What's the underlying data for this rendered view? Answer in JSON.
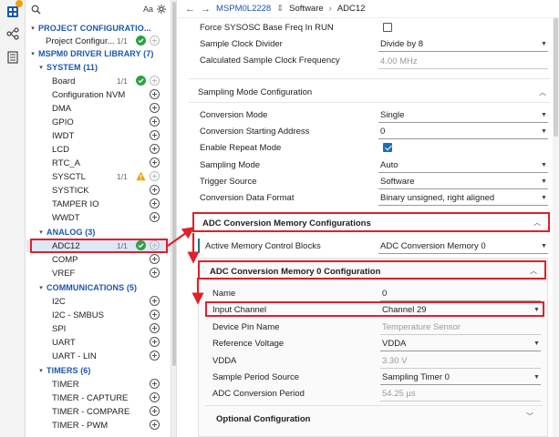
{
  "breadcrumb": {
    "device": "MSPM0L2228",
    "section": "Software",
    "page": "ADC12"
  },
  "tree": {
    "search_icon": "search-icon",
    "case_toggle": "Aa",
    "groups": [
      {
        "id": "project",
        "label": "PROJECT CONFIGURATIO...",
        "level": 0
      },
      {
        "id": "project-item",
        "label": "Project Configur...",
        "count": "1/1",
        "status": "ok"
      },
      {
        "id": "driver",
        "label": "MSPM0 DRIVER LIBRARY (7)",
        "level": 0
      },
      {
        "id": "system",
        "label": "SYSTEM (11)",
        "level": 1
      }
    ],
    "system_items": [
      "Board",
      "Configuration NVM",
      "DMA",
      "GPIO",
      "IWDT",
      "LCD",
      "RTC_A",
      "SYSCTL",
      "SYSTICK",
      "TAMPER IO",
      "WWDT"
    ],
    "board_count": "1/1",
    "sysctl_count": "1/1",
    "analog_header": "ANALOG (3)",
    "analog_items": [
      "ADC12",
      "COMP",
      "VREF"
    ],
    "adc12_count": "1/1",
    "comm_header": "COMMUNICATIONS (5)",
    "comm_items": [
      "I2C",
      "I2C - SMBUS",
      "SPI",
      "UART",
      "UART - LIN"
    ],
    "timers_header": "TIMERS (6)",
    "timers_items": [
      "TIMER",
      "TIMER - CAPTURE",
      "TIMER - COMPARE",
      "TIMER - PWM"
    ]
  },
  "fields": {
    "force_sysosc": {
      "label": "Force SYSOSC Base Freq In RUN",
      "checked": false
    },
    "sample_clock_divider": {
      "label": "Sample Clock Divider",
      "value": "Divide by 8"
    },
    "calc_sample_clock": {
      "label": "Calculated Sample Clock Frequency",
      "value": "4.00 MHz"
    },
    "sampling_mode_config": "Sampling Mode Configuration",
    "conversion_mode": {
      "label": "Conversion Mode",
      "value": "Single"
    },
    "conversion_start_addr": {
      "label": "Conversion Starting Address",
      "value": "0"
    },
    "enable_repeat": {
      "label": "Enable Repeat Mode",
      "checked": true
    },
    "sampling_mode": {
      "label": "Sampling Mode",
      "value": "Auto"
    },
    "trigger_source": {
      "label": "Trigger Source",
      "value": "Software"
    },
    "conversion_data_format": {
      "label": "Conversion Data Format",
      "value": "Binary unsigned, right aligned"
    },
    "adc_mem_configs": "ADC Conversion Memory Configurations",
    "active_mem_blocks": {
      "label": "Active Memory Control Blocks",
      "value": "ADC Conversion Memory 0"
    },
    "adc_mem0_config": "ADC Conversion Memory 0 Configuration",
    "name": {
      "label": "Name",
      "value": "0"
    },
    "input_channel": {
      "label": "Input Channel",
      "value": "Channel 29"
    },
    "device_pin_name": {
      "label": "Device Pin Name",
      "value": "Temperature Sensor"
    },
    "reference_voltage": {
      "label": "Reference Voltage",
      "value": "VDDA"
    },
    "vdda": {
      "label": "VDDA",
      "value": "3.30 V"
    },
    "sample_period_source": {
      "label": "Sample Period Source",
      "value": "Sampling Timer 0"
    },
    "adc_conversion_period": {
      "label": "ADC Conversion Period",
      "value": "54.25 µs"
    },
    "optional_config": "Optional Configuration"
  },
  "colors": {
    "accent": "#1a56b0",
    "highlight": "#e0202a",
    "ok": "#2ea043",
    "warn": "#f0a30a"
  }
}
